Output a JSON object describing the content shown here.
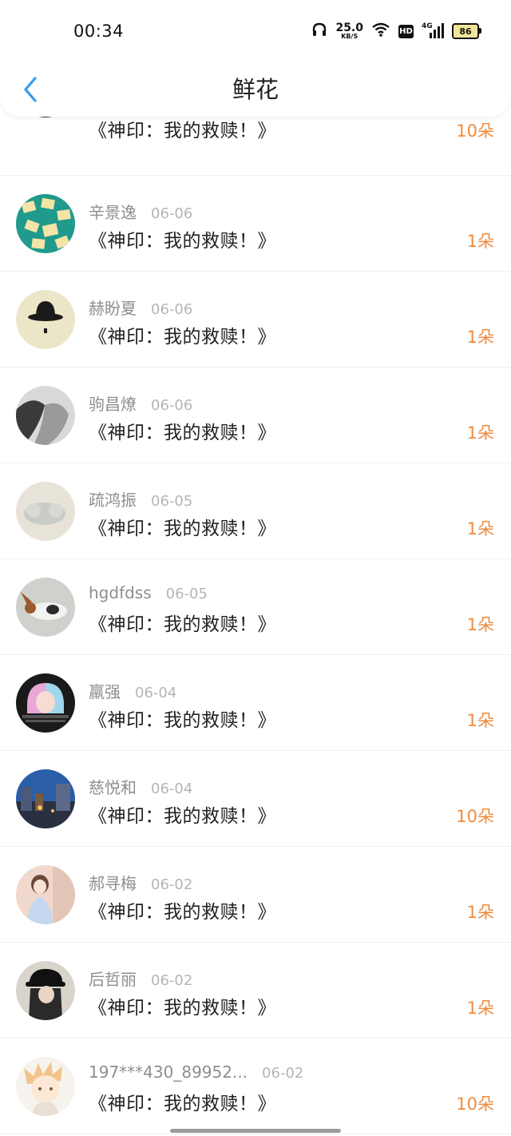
{
  "status_bar": {
    "time": "00:34",
    "net_speed_value": "25.0",
    "net_speed_unit": "KB/S",
    "hd_label": "HD",
    "signal_label": "4G",
    "battery": "86",
    "icons": [
      "headphones-icon",
      "wifi-icon",
      "hd-icon",
      "signal-4g-icon",
      "battery-icon"
    ]
  },
  "header": {
    "title": "鲜花",
    "back_icon": "chevron-left-icon"
  },
  "colors": {
    "accent_orange": "#f08b3c",
    "back_blue": "#3a9ae8",
    "name_gray": "#8e8e8e",
    "date_gray": "#b5b5b5"
  },
  "records": [
    {
      "name": "",
      "date": "",
      "book": "《神印：我的救赎！》",
      "amount": "10朵"
    },
    {
      "name": "辛景逸",
      "date": "06-06",
      "book": "《神印：我的救赎！》",
      "amount": "1朵"
    },
    {
      "name": "赫盼夏",
      "date": "06-06",
      "book": "《神印：我的救赎！》",
      "amount": "1朵"
    },
    {
      "name": "驹昌燎",
      "date": "06-06",
      "book": "《神印：我的救赎！》",
      "amount": "1朵"
    },
    {
      "name": "疏鸿振",
      "date": "06-05",
      "book": "《神印：我的救赎！》",
      "amount": "1朵"
    },
    {
      "name": "hgdfdss",
      "date": "06-05",
      "book": "《神印：我的救赎！》",
      "amount": "1朵"
    },
    {
      "name": "羸强",
      "date": "06-04",
      "book": "《神印：我的救赎！》",
      "amount": "1朵"
    },
    {
      "name": "慈悦和",
      "date": "06-04",
      "book": "《神印：我的救赎！》",
      "amount": "10朵"
    },
    {
      "name": "郝寻梅",
      "date": "06-02",
      "book": "《神印：我的救赎！》",
      "amount": "1朵"
    },
    {
      "name": "后哲丽",
      "date": "06-02",
      "book": "《神印：我的救赎！》",
      "amount": "1朵"
    },
    {
      "name": "197***430_89952...",
      "date": "06-02",
      "book": "《神印：我的救赎！》",
      "amount": "10朵"
    }
  ]
}
